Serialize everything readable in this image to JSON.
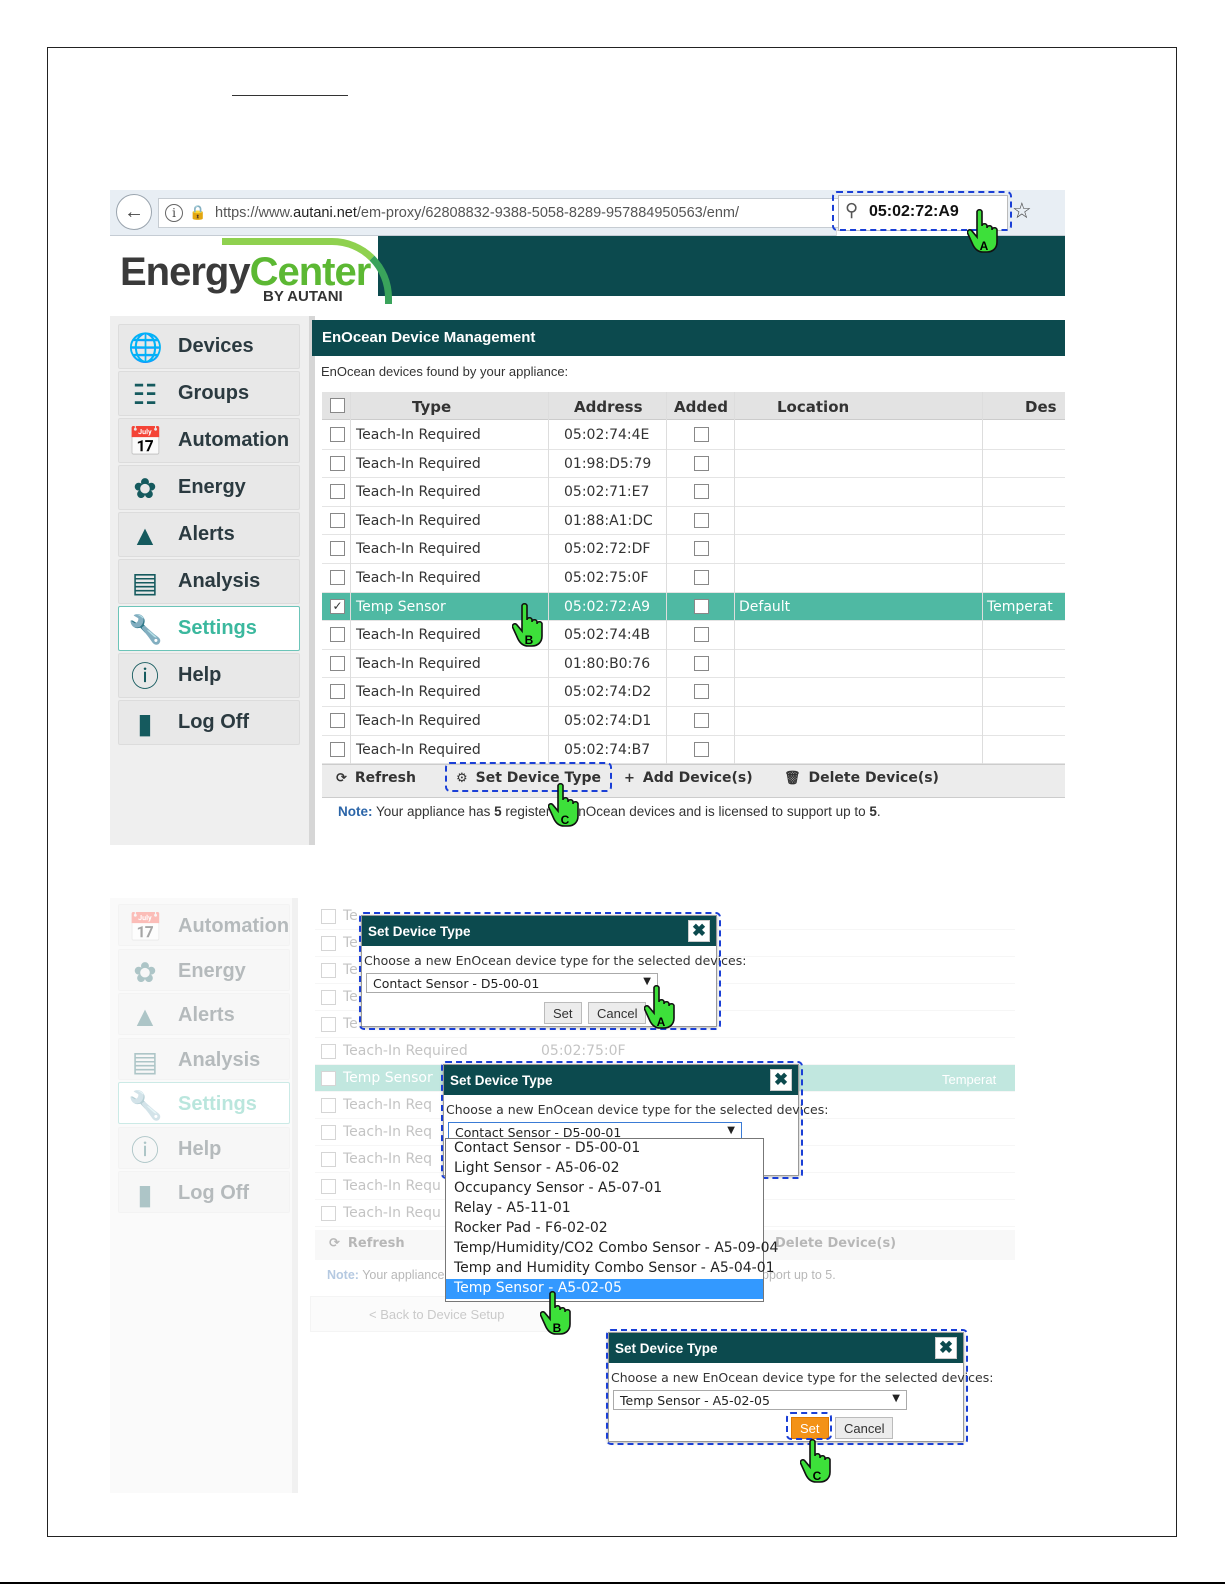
{
  "browser": {
    "url_prefix": "https://www.",
    "url_domain": "autani.net",
    "url_rest": "/em-proxy/62808832-9388-5058-8289-957884950563/enm/",
    "search_value": "05:02:72:A9"
  },
  "logo": {
    "word1": "Energy",
    "word2": "Center",
    "byline": "BY AUTANI"
  },
  "sidebar": [
    {
      "label": "Devices",
      "icon": "globe-icon"
    },
    {
      "label": "Groups",
      "icon": "org-chart-icon"
    },
    {
      "label": "Automation",
      "icon": "calendar-icon"
    },
    {
      "label": "Energy",
      "icon": "leaf-icon"
    },
    {
      "label": "Alerts",
      "icon": "warning-icon"
    },
    {
      "label": "Analysis",
      "icon": "bar-chart-icon"
    },
    {
      "label": "Settings",
      "icon": "tools-icon",
      "active": true
    },
    {
      "label": "Help",
      "icon": "info-icon"
    },
    {
      "label": "Log Off",
      "icon": "door-icon"
    }
  ],
  "panel": {
    "title": "EnOcean Device Management",
    "subtitle": "EnOcean devices found by your appliance:"
  },
  "table": {
    "headers": {
      "type": "Type",
      "address": "Address",
      "added": "Added",
      "location": "Location",
      "description": "Des"
    },
    "rows": [
      {
        "type": "Teach-In Required",
        "address": "05:02:74:4E"
      },
      {
        "type": "Teach-In Required",
        "address": "01:98:D5:79"
      },
      {
        "type": "Teach-In Required",
        "address": "05:02:71:E7"
      },
      {
        "type": "Teach-In Required",
        "address": "01:88:A1:DC"
      },
      {
        "type": "Teach-In Required",
        "address": "05:02:72:DF"
      },
      {
        "type": "Teach-In Required",
        "address": "05:02:75:0F"
      },
      {
        "type": "Temp Sensor",
        "address": "05:02:72:A9",
        "location": "Default",
        "description": "Temperat",
        "selected": true
      },
      {
        "type": "Teach-In Required",
        "address": "05:02:74:4B"
      },
      {
        "type": "Teach-In Required",
        "address": "01:80:B0:76"
      },
      {
        "type": "Teach-In Required",
        "address": "05:02:74:D2"
      },
      {
        "type": "Teach-In Required",
        "address": "05:02:74:D1"
      },
      {
        "type": "Teach-In Required",
        "address": "05:02:74:B7"
      }
    ]
  },
  "toolbar": {
    "refresh": "Refresh",
    "set_type": "Set Device Type",
    "add": "Add Device(s)",
    "delete": "Delete Device(s)"
  },
  "note": {
    "label": "Note:",
    "text_before": "Your appliance has",
    "count": "5",
    "text_mid": "registered EnOcean devices and is licensed to support up to",
    "limit": "5",
    "end": "."
  },
  "callouts": {
    "a": "A",
    "b": "B",
    "c": "C"
  },
  "dialog": {
    "title": "Set Device Type",
    "prompt": "Choose a new EnOcean device type for the selected devices:",
    "current": "Contact Sensor - D5-00-01",
    "final": "Temp Sensor - A5-02-05",
    "set_label": "Set",
    "cancel_label": "Cancel",
    "options": [
      "Contact Sensor - D5-00-01",
      "Light Sensor - A5-06-02",
      "Occupancy Sensor - A5-07-01",
      "Relay - A5-11-01",
      "Rocker Pad - F6-02-02",
      "Temp/Humidity/CO2 Combo Sensor - A5-09-04",
      "Temp and Humidity Combo Sensor - A5-04-01",
      "Temp Sensor - A5-02-05"
    ]
  },
  "shot2": {
    "sidebar": [
      "Automation",
      "Energy",
      "Alerts",
      "Analysis",
      "Settings",
      "Help",
      "Log Off"
    ],
    "bg_rows": [
      {
        "type": "Te",
        "address": ""
      },
      {
        "type": "Te",
        "address": ""
      },
      {
        "type": "Te",
        "address": ""
      },
      {
        "type": "Te",
        "address": ""
      },
      {
        "type": "Te",
        "address": ""
      },
      {
        "type": "Teach-In Required",
        "address": "05:02:75:0F"
      },
      {
        "type": "Temp Sensor",
        "address": "",
        "selected": true
      },
      {
        "type": "Teach-In Req",
        "address": ""
      },
      {
        "type": "Teach-In Req",
        "address": ""
      },
      {
        "type": "Teach-In Req",
        "address": ""
      },
      {
        "type": "Teach-In Requ",
        "address": ""
      },
      {
        "type": "Teach-In Requ",
        "address": ""
      }
    ],
    "selected_desc": "Temperat",
    "refresh": "Refresh",
    "delete": "Delete Device(s)",
    "note_label": "Note:",
    "note_left": "Your appliance",
    "note_right": "pport up to 5.",
    "back": "< Back to Device Setup"
  }
}
